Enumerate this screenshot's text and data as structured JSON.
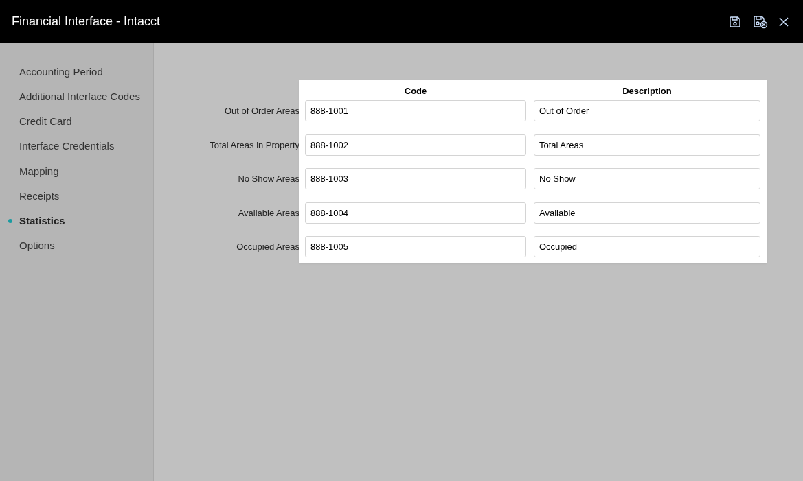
{
  "window": {
    "title": "Financial Interface - Intacct"
  },
  "sidebar": {
    "items": [
      {
        "label": "Accounting Period",
        "selected": false
      },
      {
        "label": "Additional Interface Codes",
        "selected": false
      },
      {
        "label": "Credit Card",
        "selected": false
      },
      {
        "label": "Interface Credentials",
        "selected": false
      },
      {
        "label": "Mapping",
        "selected": false
      },
      {
        "label": "Receipts",
        "selected": false
      },
      {
        "label": "Statistics",
        "selected": true
      },
      {
        "label": "Options",
        "selected": false
      }
    ]
  },
  "table": {
    "columns": [
      "Code",
      "Description"
    ],
    "rows": [
      {
        "label": "Out of Order Areas",
        "code": "888-1001",
        "description": "Out of Order"
      },
      {
        "label": "Total Areas in Property",
        "code": "888-1002",
        "description": "Total Areas"
      },
      {
        "label": "No Show Areas",
        "code": "888-1003",
        "description": "No Show"
      },
      {
        "label": "Available Areas",
        "code": "888-1004",
        "description": "Available"
      },
      {
        "label": "Occupied Areas",
        "code": "888-1005",
        "description": "Occupied"
      }
    ]
  }
}
